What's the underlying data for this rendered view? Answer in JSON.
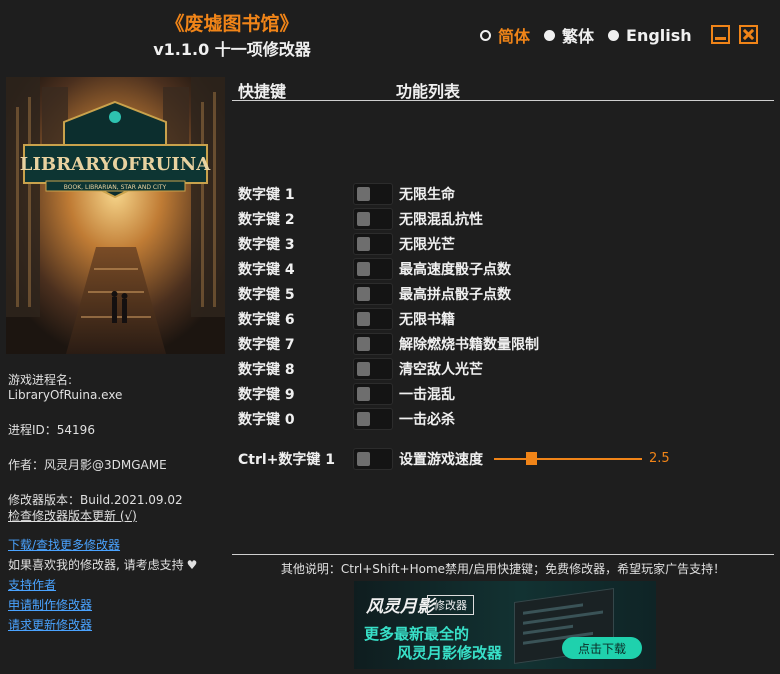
{
  "header": {
    "title": "《废墟图书馆》",
    "subtitle": "v1.1.0 十一项修改器"
  },
  "languages": [
    {
      "label": "简体",
      "selected": true
    },
    {
      "label": "繁体",
      "selected": false
    },
    {
      "label": "English",
      "selected": false
    }
  ],
  "cover": {
    "logo_text": "LIBRARYOFRUINA",
    "tagline": "BOOK, LIBRARIAN, STAR AND CITY"
  },
  "info": {
    "process_name_label": "游戏进程名:",
    "process_name": "LibraryOfRuina.exe",
    "process_id": "进程ID：54196",
    "author": "作者：风灵月影@3DMGAME",
    "version": "修改器版本：Build.2021.09.02",
    "check_update": "检查修改器版本更新 (√)"
  },
  "links": {
    "download_more": "下载/查找更多修改器",
    "support_prompt": "如果喜欢我的修改器, 请考虑支持",
    "heart": "♥",
    "support_author": "支持作者",
    "request_trainer": "申请制作修改器",
    "request_update": "请求更新修改器"
  },
  "columns": {
    "hotkey": "快捷键",
    "features": "功能列表"
  },
  "cheats": [
    {
      "hotkey": "数字键 1",
      "name": "无限生命",
      "enabled": false
    },
    {
      "hotkey": "数字键 2",
      "name": "无限混乱抗性",
      "enabled": false
    },
    {
      "hotkey": "数字键 3",
      "name": "无限光芒",
      "enabled": false
    },
    {
      "hotkey": "数字键 4",
      "name": "最高速度骰子点数",
      "enabled": false
    },
    {
      "hotkey": "数字键 5",
      "name": "最高拼点骰子点数",
      "enabled": false
    },
    {
      "hotkey": "数字键 6",
      "name": "无限书籍",
      "enabled": false
    },
    {
      "hotkey": "数字键 7",
      "name": "解除燃烧书籍数量限制",
      "enabled": false
    },
    {
      "hotkey": "数字键 8",
      "name": "清空敌人光芒",
      "enabled": false
    },
    {
      "hotkey": "数字键 9",
      "name": "一击混乱",
      "enabled": false
    },
    {
      "hotkey": "数字键 0",
      "name": "一击必杀",
      "enabled": false
    }
  ],
  "speed": {
    "hotkey": "Ctrl+数字键 1",
    "name": "设置游戏速度",
    "value": "2.5",
    "enabled": false
  },
  "footer": {
    "note": "其他说明：Ctrl+Shift+Home禁用/启用快捷键；免费修改器，希望玩家广告支持！"
  },
  "banner": {
    "brand": "风灵月影",
    "tag": "修改器",
    "line1": "更多最新最全的",
    "line2": "风灵月影修改器",
    "button": "点击下载"
  },
  "colors": {
    "accent": "#f08418",
    "background": "#1e1e1e",
    "link": "#4aa3ff",
    "banner_accent": "#38e0c8"
  }
}
